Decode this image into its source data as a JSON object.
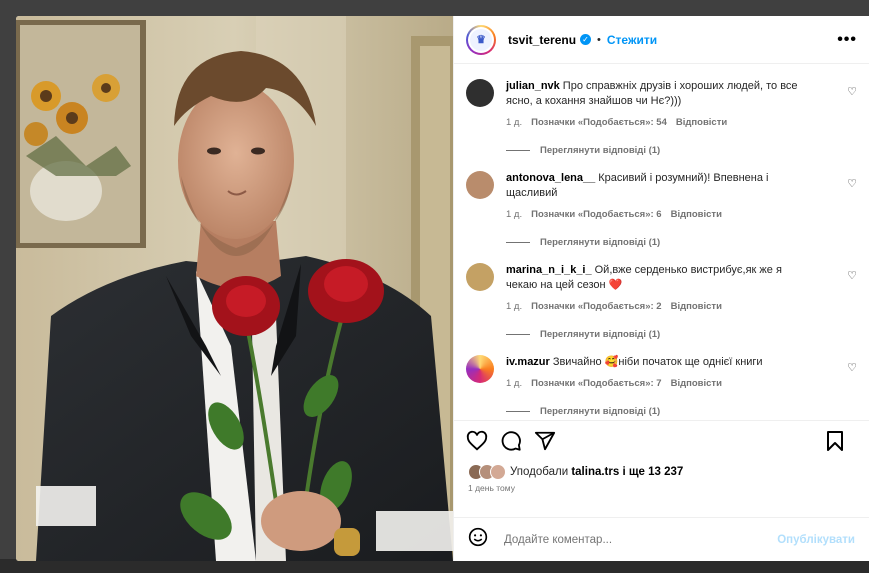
{
  "post_header": {
    "username": "tsvit_terenu",
    "separator": "•",
    "follow_label": "Стежити",
    "more_label": "•••"
  },
  "comments": [
    {
      "username": "julian_nvk",
      "text": "Про справжніх друзів і хороших людей, то все ясно, а кохання знайшов чи Нє?)))",
      "time": "1 д.",
      "likes": "Позначки «Подобається»: 54",
      "reply": "Відповісти",
      "view_replies": "Переглянути відповіді (1)"
    },
    {
      "username": "antonova_lena__",
      "text": "Красивий і розумний)! Впевнена і щасливий",
      "time": "1 д.",
      "likes": "Позначки «Подобається»: 6",
      "reply": "Відповісти",
      "view_replies": "Переглянути відповіді (1)"
    },
    {
      "username": "marina_n_i_k_i_",
      "text": "Ой,вже серденько вистрибує,як же я чекаю на цей сезон ❤️",
      "time": "1 д.",
      "likes": "Позначки «Подобається»: 2",
      "reply": "Відповісти",
      "view_replies": "Переглянути відповіді (1)"
    },
    {
      "username": "iv.mazur",
      "text": "Звичайно 🥰ніби початок ще однієї книги",
      "time": "1 д.",
      "likes": "Позначки «Подобається»: 7",
      "reply": "Відповісти",
      "view_replies": "Переглянути відповіді (1)"
    }
  ],
  "likes_summary": {
    "prefix": "Уподобали",
    "user": "talina.trs",
    "suffix": "і ще 13 237"
  },
  "posted_time": "1 день тому",
  "add_comment": {
    "placeholder": "Додайте коментар...",
    "publish_label": "Опублікувати"
  },
  "colors": {
    "accent": "#0095f6",
    "publish_disabled": "#b2dffc",
    "heart_red": "#ed4956"
  }
}
